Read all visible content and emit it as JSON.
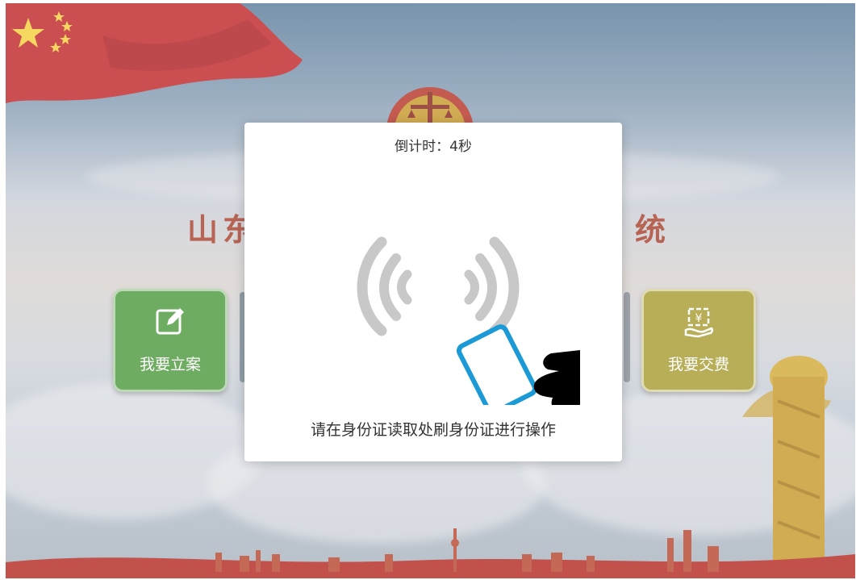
{
  "background": {
    "title_left": "山东",
    "title_right": "统"
  },
  "tiles": [
    {
      "label": "我要立案",
      "icon": "edit-icon",
      "color": "#4e9a3f"
    },
    {
      "label": "我要交费",
      "icon": "yuan-payment-icon",
      "color": "#a99d34"
    }
  ],
  "modal": {
    "countdown": "倒计时：4秒",
    "instruction": "请在身份证读取处刷身份证进行操作",
    "illustration_icon": "id-card-swipe-icon"
  },
  "colors": {
    "accent_red": "#a8432f",
    "tile_green": "#4e9a3f",
    "tile_olive": "#a99d34"
  }
}
